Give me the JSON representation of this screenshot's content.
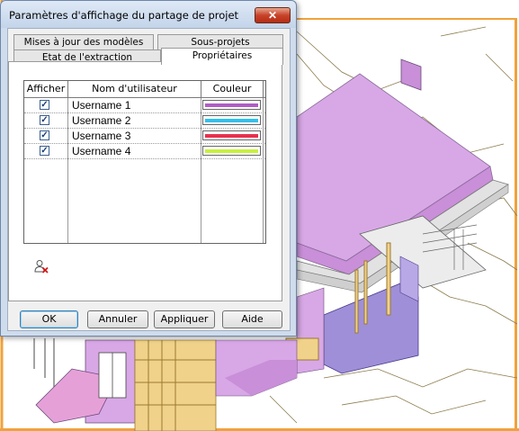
{
  "dialog": {
    "title": "Paramètres d'affichage du partage de projet",
    "close_glyph": "✕",
    "tabs": [
      {
        "label": "Mises à jour des modèles",
        "active": false
      },
      {
        "label": "Sous-projets",
        "active": false
      },
      {
        "label": "Etat de l'extraction",
        "active": false
      },
      {
        "label": "Propriétaires",
        "active": true
      }
    ],
    "table": {
      "headers": [
        "Afficher",
        "Nom d'utilisateur",
        "Couleur"
      ],
      "rows": [
        {
          "checked": true,
          "username": "Username 1",
          "color": "#b05cc4"
        },
        {
          "checked": true,
          "username": "Username 2",
          "color": "#33c0ea"
        },
        {
          "checked": true,
          "username": "Username 3",
          "color": "#e8304f"
        },
        {
          "checked": true,
          "username": "Username 4",
          "color": "#c8f03c"
        }
      ]
    },
    "owner_icon": "remove-user-icon",
    "buttons": {
      "ok": "OK",
      "cancel": "Annuler",
      "apply": "Appliquer",
      "help": "Aide"
    }
  },
  "viewport": {
    "content": "3D architectural model view",
    "colors": {
      "border": "#f0a23c",
      "highlight_owner": "#d6a6e0",
      "slab": "#d8a8e6",
      "wall": "#9f8fd8",
      "timber": "#f1d28a"
    }
  }
}
